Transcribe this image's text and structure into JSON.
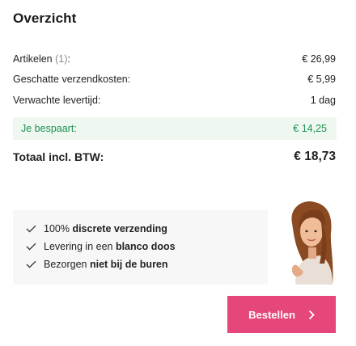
{
  "summary": {
    "title": "Overzicht",
    "rows": [
      {
        "label": "Artikelen",
        "count": "(1)",
        "suffix": ":",
        "value": "€ 26,99"
      },
      {
        "label": "Geschatte verzendkosten:",
        "value": "€ 5,99"
      },
      {
        "label": "Verwachte levertijd:",
        "value": "1 dag"
      }
    ],
    "savings": {
      "label": "Je bespaart:",
      "value": "€ 14,25"
    },
    "total": {
      "label": "Totaal incl. BTW:",
      "value": "€ 18,73"
    }
  },
  "perks": [
    {
      "pre": "100% ",
      "bold": "discrete verzending",
      "post": ""
    },
    {
      "pre": "Levering in een ",
      "bold": "blanco doos",
      "post": ""
    },
    {
      "pre": "Bezorgen ",
      "bold": "niet bij de buren",
      "post": ""
    }
  ],
  "checkout": {
    "label": "Bestellen"
  },
  "colors": {
    "accent": "#e5477a",
    "savings_green": "#1e9151",
    "savings_bg": "#eef8f1",
    "perks_bg": "#f7f7f7"
  },
  "icons": {
    "perk": "checkmark-icon",
    "button": "chevron-right-icon",
    "illustration": "woman-illustration-icon"
  }
}
